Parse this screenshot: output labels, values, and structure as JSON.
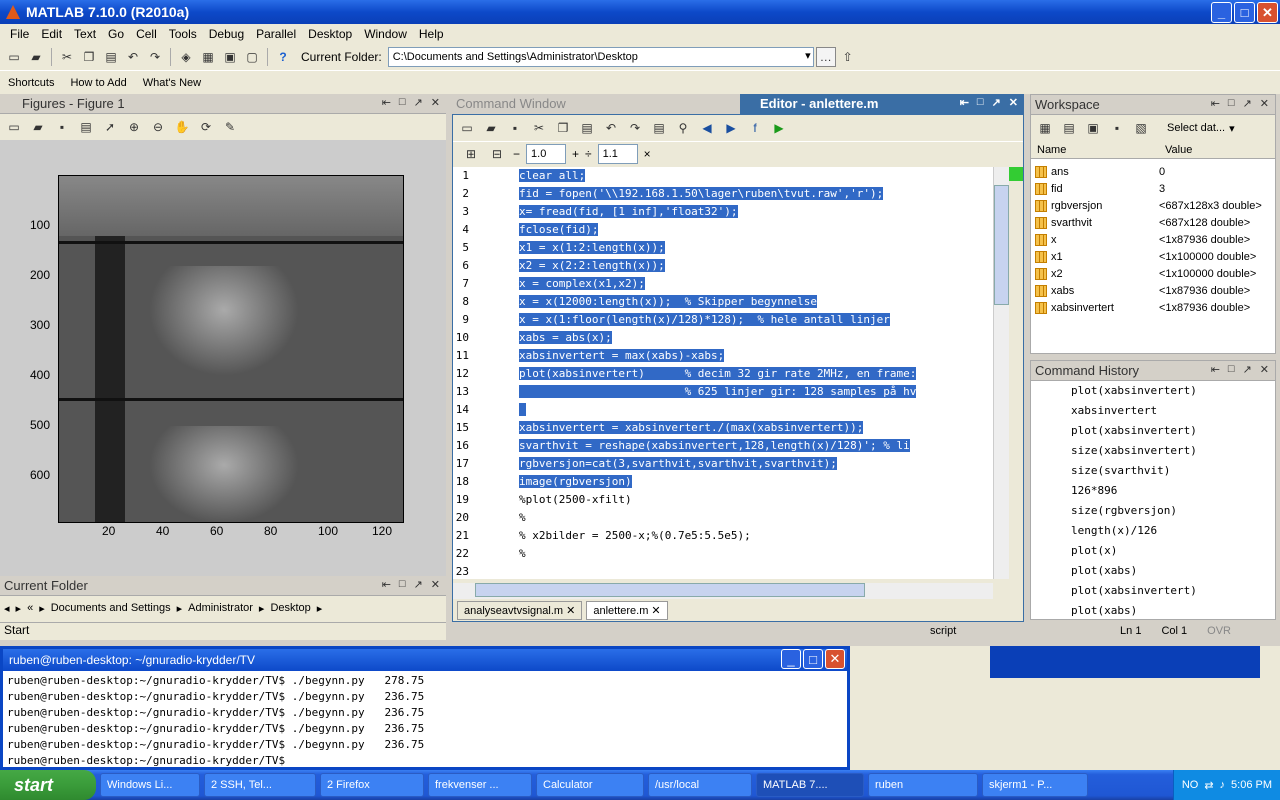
{
  "window": {
    "title": "MATLAB  7.10.0 (R2010a)"
  },
  "menu": [
    "File",
    "Edit",
    "Text",
    "Go",
    "Cell",
    "Tools",
    "Debug",
    "Parallel",
    "Desktop",
    "Window",
    "Help"
  ],
  "current_folder": {
    "label": "Current Folder:",
    "path": "C:\\Documents and Settings\\Administrator\\Desktop"
  },
  "shortcuts": {
    "label": "Shortcuts",
    "howto": "How to Add",
    "whatsnew": "What's New"
  },
  "figure": {
    "title": "Figures - Figure 1",
    "y_ticks": [
      "100",
      "200",
      "300",
      "400",
      "500",
      "600"
    ],
    "x_ticks": [
      "20",
      "40",
      "60",
      "80",
      "100",
      "120"
    ]
  },
  "current_folder_panel": {
    "title": "Current Folder",
    "crumbs": [
      "«",
      "Documents and Settings",
      "Administrator",
      "Desktop"
    ]
  },
  "command_window": {
    "title": "Command Window"
  },
  "editor": {
    "title": "Editor - anlettere.m",
    "zoom1": "1.0",
    "zoom2": "1.1",
    "lines": [
      {
        "n": "1",
        "t": "clear all;",
        "sel": true
      },
      {
        "n": "2",
        "t": "fid = fopen('\\\\192.168.1.50\\lager\\ruben\\tvut.raw','r');",
        "sel": true
      },
      {
        "n": "3",
        "t": "x= fread(fid, [1 inf],'float32');",
        "sel": true
      },
      {
        "n": "4",
        "t": "fclose(fid);",
        "sel": true
      },
      {
        "n": "5",
        "t": "x1 = x(1:2:length(x));",
        "sel": true
      },
      {
        "n": "6",
        "t": "x2 = x(2:2:length(x));",
        "sel": true
      },
      {
        "n": "7",
        "t": "x = complex(x1,x2);",
        "sel": true
      },
      {
        "n": "8",
        "t": "x = x(12000:length(x));  % Skipper begynnelse",
        "sel": true
      },
      {
        "n": "9",
        "t": "x = x(1:floor(length(x)/128)*128);  % hele antall linjer",
        "sel": true
      },
      {
        "n": "10",
        "t": "xabs = abs(x);",
        "sel": true
      },
      {
        "n": "11",
        "t": "xabsinvertert = max(xabs)-xabs;",
        "sel": true
      },
      {
        "n": "12",
        "t": "plot(xabsinvertert)      % decim 32 gir rate 2MHz, en frame:",
        "sel": true
      },
      {
        "n": "13",
        "t": "                         % 625 linjer gir: 128 samples på hv",
        "sel": true
      },
      {
        "n": "14",
        "t": " ",
        "sel": true
      },
      {
        "n": "15",
        "t": "xabsinvertert = xabsinvertert./(max(xabsinvertert));",
        "sel": true
      },
      {
        "n": "16",
        "t": "svarthvit = reshape(xabsinvertert,128,length(x)/128)'; % li",
        "sel": true
      },
      {
        "n": "17",
        "t": "rgbversjon=cat(3,svarthvit,svarthvit,svarthvit);",
        "sel": true
      },
      {
        "n": "18",
        "t": "image(rgbversjon)",
        "sel": true
      },
      {
        "n": "19",
        "t": "",
        "sel": false
      },
      {
        "n": "20",
        "t": "%plot(2500-xfilt)",
        "sel": false
      },
      {
        "n": "21",
        "t": "%",
        "sel": false
      },
      {
        "n": "22",
        "t": "% x2bilder = 2500-x;%(0.7e5:5.5e5);",
        "sel": false
      },
      {
        "n": "23",
        "t": "%",
        "sel": false
      }
    ],
    "tabs": [
      "analyseavtvsignal.m",
      "anlettere.m"
    ]
  },
  "status": {
    "mode": "script",
    "ln_label": "Ln",
    "ln": "1",
    "col_label": "Col",
    "col": "1",
    "ovr": "OVR"
  },
  "workspace": {
    "title": "Workspace",
    "select": "Select dat...",
    "col_name": "Name",
    "col_value": "Value",
    "rows": [
      {
        "name": "ans",
        "value": "0"
      },
      {
        "name": "fid",
        "value": "3"
      },
      {
        "name": "rgbversjon",
        "value": "<687x128x3 double>"
      },
      {
        "name": "svarthvit",
        "value": "<687x128 double>"
      },
      {
        "name": "x",
        "value": "<1x87936 double>"
      },
      {
        "name": "x1",
        "value": "<1x100000 double>"
      },
      {
        "name": "x2",
        "value": "<1x100000 double>"
      },
      {
        "name": "xabs",
        "value": "<1x87936 double>"
      },
      {
        "name": "xabsinvertert",
        "value": "<1x87936 double>"
      }
    ]
  },
  "history": {
    "title": "Command History",
    "items": [
      "plot(xabsinvertert)",
      "xabsinvertert",
      "plot(xabsinvertert)",
      "size(xabsinvertert)",
      "size(svarthvit)",
      "126*896",
      "size(rgbversjon)",
      "length(x)/126",
      "plot(x)",
      "plot(xabs)",
      "plot(xabsinvertert)",
      "plot(xabs)"
    ]
  },
  "start_label": "Start",
  "terminal": {
    "title": "ruben@ruben-desktop: ~/gnuradio-krydder/TV",
    "lines": [
      "ruben@ruben-desktop:~/gnuradio-krydder/TV$ ./begynn.py   278.75",
      "ruben@ruben-desktop:~/gnuradio-krydder/TV$ ./begynn.py   236.75",
      "ruben@ruben-desktop:~/gnuradio-krydder/TV$ ./begynn.py   236.75",
      "ruben@ruben-desktop:~/gnuradio-krydder/TV$ ./begynn.py   236.75",
      "ruben@ruben-desktop:~/gnuradio-krydder/TV$ ./begynn.py   236.75",
      "ruben@ruben-desktop:~/gnuradio-krydder/TV$ "
    ]
  },
  "taskbar": {
    "start": "start",
    "tasks": [
      {
        "label": "Windows Li...",
        "w": 100
      },
      {
        "label": "2 SSH, Tel...",
        "w": 112
      },
      {
        "label": "2 Firefox",
        "w": 104
      },
      {
        "label": "frekvenser ...",
        "w": 104
      },
      {
        "label": "Calculator",
        "w": 108
      },
      {
        "label": "/usr/local",
        "w": 104
      },
      {
        "label": "MATLAB 7....",
        "w": 108
      },
      {
        "label": "ruben",
        "w": 110
      },
      {
        "label": "skjerm1 - P...",
        "w": 106
      }
    ],
    "lang": "NO",
    "time": "5:06 PM"
  }
}
